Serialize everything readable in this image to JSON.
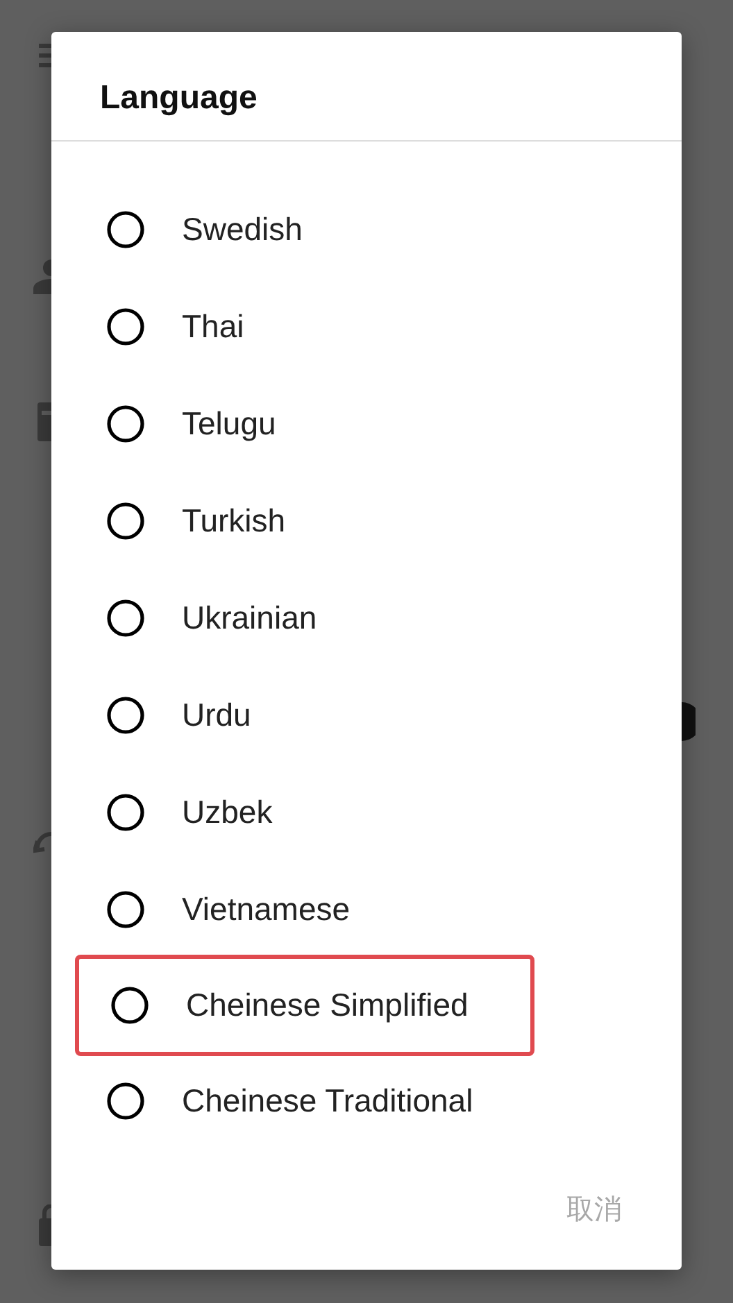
{
  "dialog": {
    "title": "Language",
    "options": [
      {
        "label": "Swedish",
        "selected": false,
        "highlighted": false
      },
      {
        "label": "Thai",
        "selected": false,
        "highlighted": false
      },
      {
        "label": "Telugu",
        "selected": false,
        "highlighted": false
      },
      {
        "label": "Turkish",
        "selected": false,
        "highlighted": false
      },
      {
        "label": "Ukrainian",
        "selected": false,
        "highlighted": false
      },
      {
        "label": "Urdu",
        "selected": false,
        "highlighted": false
      },
      {
        "label": "Uzbek",
        "selected": false,
        "highlighted": false
      },
      {
        "label": "Vietnamese",
        "selected": false,
        "highlighted": false
      },
      {
        "label": "Cheinese Simplified",
        "selected": false,
        "highlighted": true
      },
      {
        "label": "Cheinese Traditional",
        "selected": false,
        "highlighted": false
      }
    ],
    "cancel_button": "取消"
  }
}
